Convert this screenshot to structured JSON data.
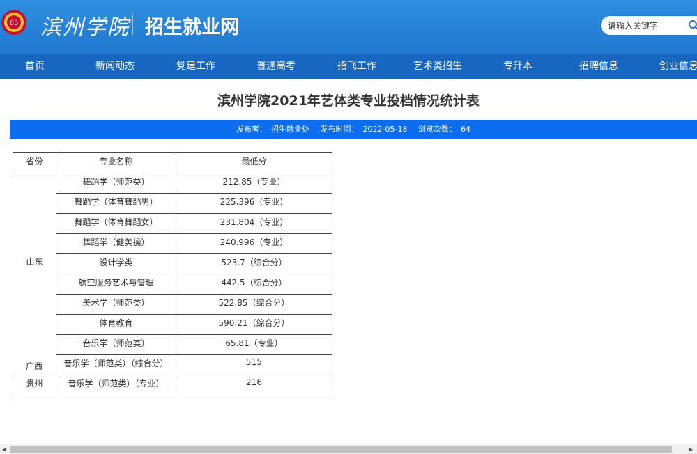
{
  "header": {
    "brand_script": "滨州学院",
    "site_name": "招生就业网",
    "search_placeholder": "请输入关键字",
    "colors": {
      "header": "#1f78cf",
      "nav": "#1767c0",
      "meta_bar": "#0b6ef0"
    }
  },
  "nav": [
    "首页",
    "新闻动态",
    "党建工作",
    "普通高考",
    "招飞工作",
    "艺术类招生",
    "专升本",
    "招聘信息",
    "创业信息"
  ],
  "article": {
    "title": "滨州学院2021年艺体类专业投档情况统计表",
    "publisher_label": "发布者：",
    "publisher": "招生就业处",
    "date_label": "发布时间：",
    "date": "2022-05-18",
    "views_label": "浏览次数：",
    "views": "64"
  },
  "table": {
    "headers": [
      "省份",
      "专业名称",
      "最低分"
    ],
    "shandong": {
      "province": "山东",
      "rows": [
        [
          "舞蹈学（师范类）",
          "212.85（专业）"
        ],
        [
          "舞蹈学（体育舞蹈男）",
          "225.396（专业）"
        ],
        [
          "舞蹈学（体育舞蹈女）",
          "231.804（专业）"
        ],
        [
          "舞蹈学（健美操）",
          "240.996（专业）"
        ],
        [
          "设计学类",
          "523.7（综合分）"
        ],
        [
          "航空服务艺术与管理",
          "442.5（综合分）"
        ],
        [
          "美术学（师范类）",
          "522.85（综合分）"
        ],
        [
          "体育教育",
          "590.21（综合分）"
        ],
        [
          "音乐学（师范类）",
          "65.81（专业）"
        ]
      ]
    },
    "guangxi": {
      "province": "广西",
      "major": "音乐学（师范类）（综合分）",
      "score": "515"
    },
    "guizhou": {
      "province": "贵州",
      "major": "音乐学（师范类）（专业）",
      "score": "216"
    }
  }
}
